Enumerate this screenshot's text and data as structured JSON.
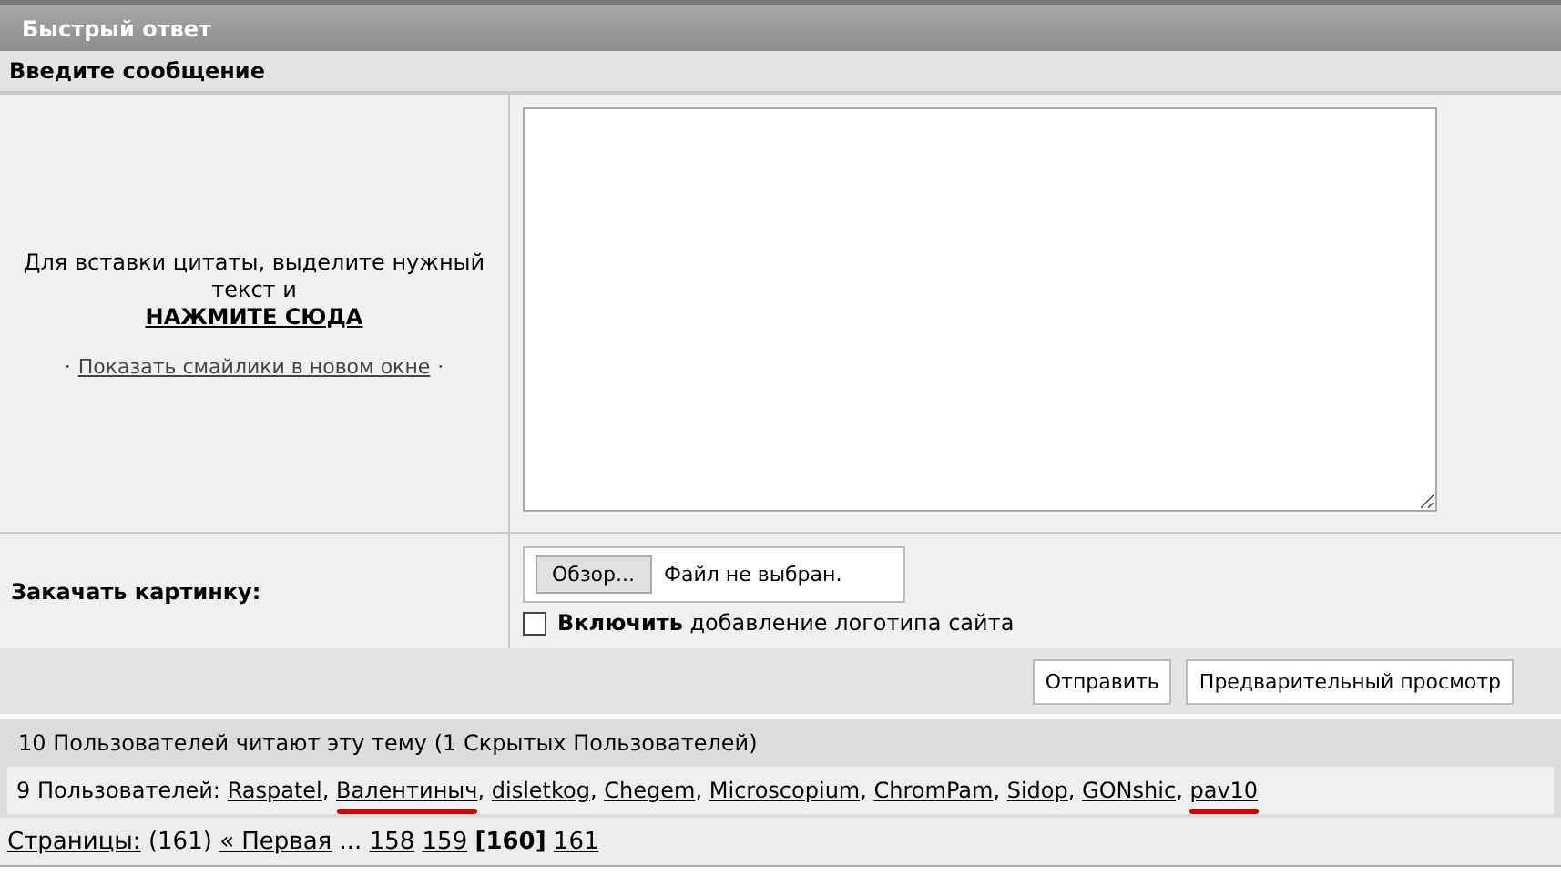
{
  "title": "Быстрый ответ",
  "subheader": "Введите сообщение",
  "quote_hint": {
    "text": "Для вставки цитаты, выделите нужный текст и",
    "link": "НАЖМИТЕ СЮДА"
  },
  "smilies": {
    "bullet_left": "·",
    "link": "Показать смайлики в новом окне",
    "bullet_right": "·"
  },
  "upload": {
    "label": "Закачать картинку:",
    "browse_button": "Обзор...",
    "file_status": "Файл не выбран.",
    "logo_option": {
      "label": "**Включить** добавление логотипа сайта",
      "checked": false
    }
  },
  "buttons": [
    {
      "label": "Отправить"
    },
    {
      "label": "Предварительный просмотр"
    }
  ],
  "readers": {
    "summary": "10 Пользователей читают эту тему (1 Скрытых Пользователей)",
    "users_label": "9 Пользователей:",
    "separator": ",",
    "users": [
      {
        "name": "Raspatel",
        "highlighted": false
      },
      {
        "name": "Валентиныч",
        "highlighted": true
      },
      {
        "name": "disletkog",
        "highlighted": false
      },
      {
        "name": "Chegem",
        "highlighted": false
      },
      {
        "name": "Microscopium",
        "highlighted": false
      },
      {
        "name": "ChromPam",
        "highlighted": false
      },
      {
        "name": "Sidop",
        "highlighted": false
      },
      {
        "name": "GONshic",
        "highlighted": false
      },
      {
        "name": "pav10",
        "highlighted": true
      }
    ]
  },
  "pagination": {
    "label": "Страницы:",
    "count": "(161)",
    "first": "« Первая",
    "ellipsis": "...",
    "pages": [
      {
        "label": "158",
        "selected": false
      },
      {
        "label": "159",
        "selected": false
      },
      {
        "label": "[160]",
        "selected": true
      },
      {
        "label": "161",
        "selected": false
      }
    ]
  }
}
